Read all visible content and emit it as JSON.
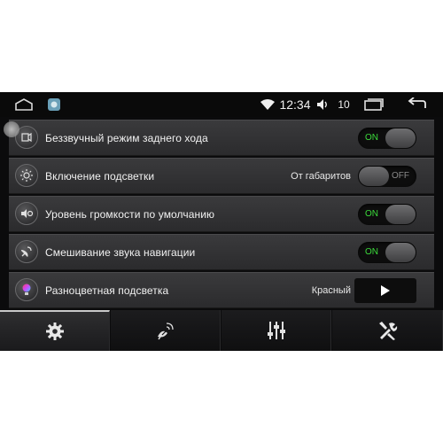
{
  "status_bar": {
    "time": "12:34",
    "volume_level": "10",
    "icons": [
      "home-outline-icon",
      "app-icon",
      "wifi-icon",
      "volume-icon",
      "recent-apps-icon",
      "back-icon"
    ]
  },
  "settings": {
    "rows": [
      {
        "label": "Беззвучный режим заднего хода",
        "icon": "rear-camera-icon",
        "control": "toggle",
        "state": "ON"
      },
      {
        "label": "Включение подсветки",
        "icon": "brightness-icon",
        "control": "toggle",
        "value": "От габаритов",
        "state": "OFF"
      },
      {
        "label": "Уровень громкости по умолчанию",
        "icon": "volume-default-icon",
        "control": "toggle",
        "state": "ON"
      },
      {
        "label": "Смешивание звука навигации",
        "icon": "navigation-mix-icon",
        "control": "toggle",
        "state": "ON"
      },
      {
        "label": "Разноцветная подсветка",
        "icon": "color-bulb-icon",
        "control": "play",
        "value": "Красный"
      }
    ]
  },
  "tabs": [
    {
      "name": "general-settings",
      "icon": "gear-icon",
      "active": true
    },
    {
      "name": "navigation-settings",
      "icon": "satellite-dish-icon",
      "active": false
    },
    {
      "name": "audio-settings",
      "icon": "equalizer-icon",
      "active": false
    },
    {
      "name": "system-settings",
      "icon": "tools-icon",
      "active": false
    }
  ],
  "colors": {
    "on_text": "#3bdc3b",
    "off_text": "#8a8a8a",
    "background": "#0b0b0c",
    "row": "#333335"
  }
}
